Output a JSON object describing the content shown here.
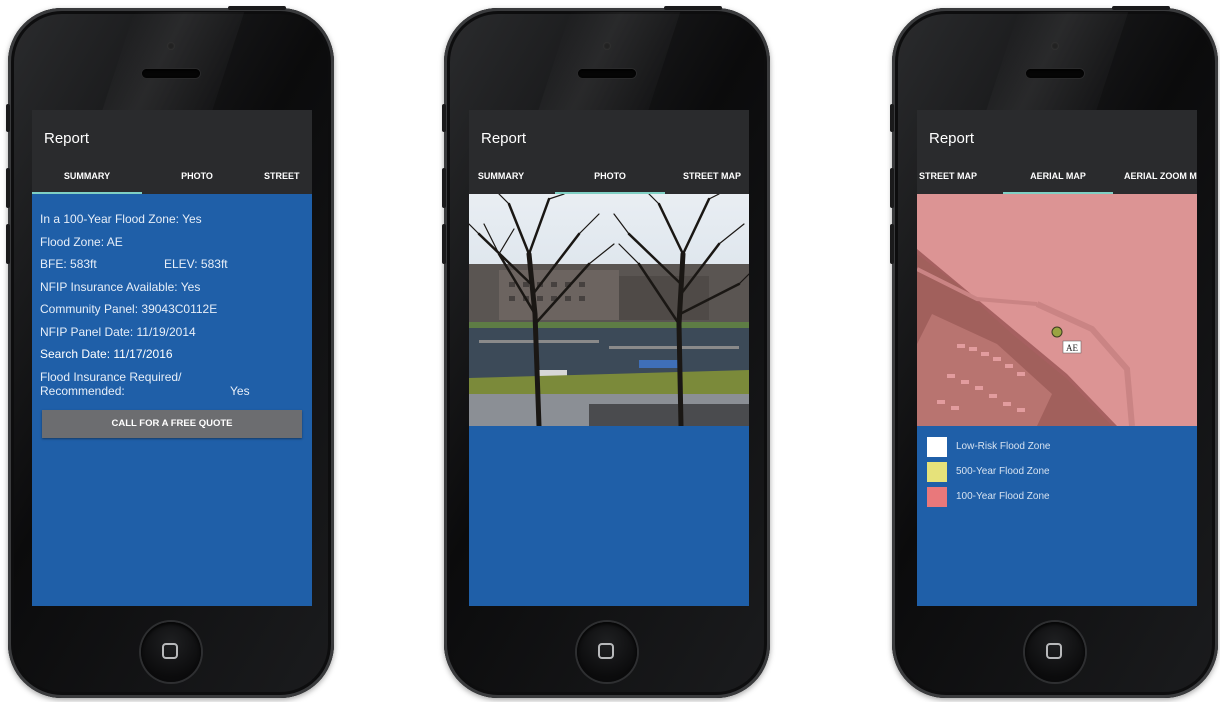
{
  "phones": [
    {
      "app_title": "Report",
      "tabs": [
        "SUMMARY",
        "PHOTO",
        "STREET"
      ],
      "active_tab": "SUMMARY",
      "summary": {
        "flood_zone_100yr_label": "In a 100-Year Flood Zone:",
        "flood_zone_100yr_value": "Yes",
        "flood_zone_label": "Flood Zone:",
        "flood_zone_value": "AE",
        "bfe_label": "BFE:",
        "bfe_value": "583ft",
        "elev_label": "ELEV:",
        "elev_value": "583ft",
        "nfip_available_label": "NFIP Insurance Available:",
        "nfip_available_value": "Yes",
        "community_panel_label": "Community Panel:",
        "community_panel_value": "39043C0112E",
        "nfip_panel_date_label": "NFIP Panel Date:",
        "nfip_panel_date_value": "11/19/2014",
        "search_date_label": "Search Date:",
        "search_date_value": "11/17/2016",
        "insurance_required_label_1": "Flood Insurance Required/",
        "insurance_required_label_2": "Recommended:",
        "insurance_required_value": "Yes"
      },
      "quote_button": "CALL FOR A FREE QUOTE"
    },
    {
      "app_title": "Report",
      "tabs": [
        "SUMMARY",
        "PHOTO",
        "STREET MAP"
      ],
      "active_tab": "PHOTO"
    },
    {
      "app_title": "Report",
      "tabs": [
        "STREET MAP",
        "AERIAL MAP",
        "AERIAL ZOOM M"
      ],
      "active_tab": "AERIAL MAP",
      "map_zone_label": "AE",
      "legend": [
        {
          "label": "Low-Risk  Flood Zone",
          "color": "#ffffff"
        },
        {
          "label": "500-Year Flood Zone",
          "color": "#e6e27a"
        },
        {
          "label": "100-Year Flood Zone",
          "color": "#e9787b"
        }
      ]
    }
  ],
  "colors": {
    "screen_bg": "#1f5fa8",
    "appbar_bg": "#2a2b2d",
    "tab_indicator": "#7fd0c4",
    "button_bg": "#6c6d70"
  }
}
